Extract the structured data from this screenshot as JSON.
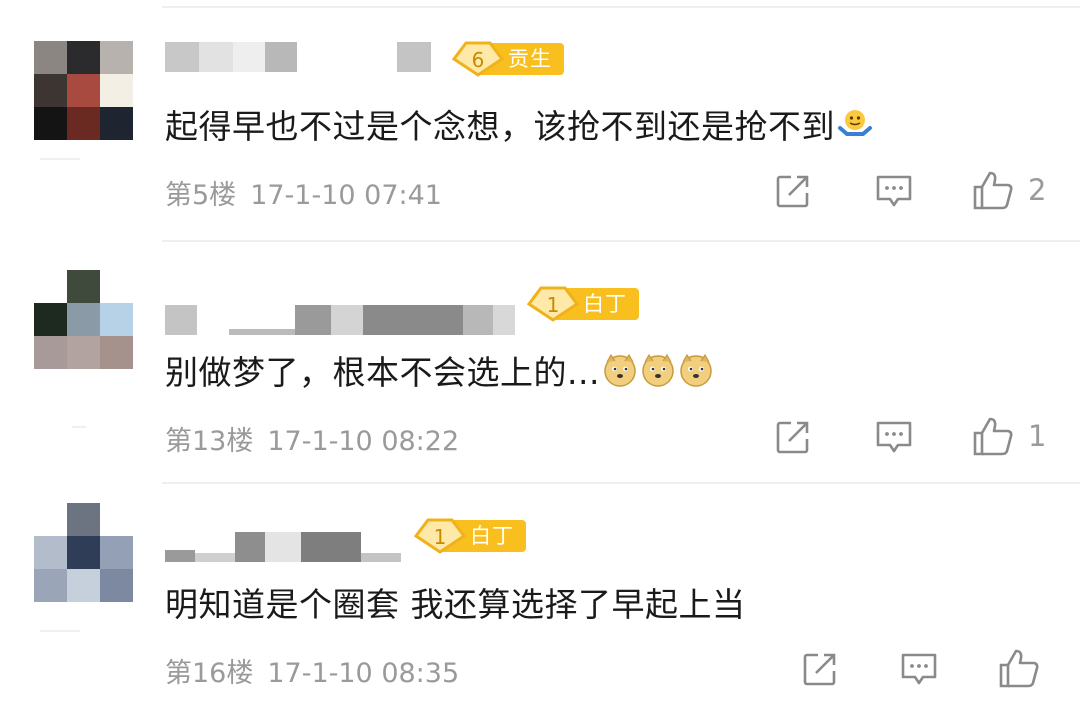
{
  "comments": [
    {
      "badge_level": "6",
      "badge_title": "贡生",
      "text": "起得早也不过是个念想，该抢不到还是抢不到",
      "emoji": "shrug-emoji",
      "floor": "第5楼",
      "time": "17-1-10 07:41",
      "likes": "2"
    },
    {
      "badge_level": "1",
      "badge_title": "白丁",
      "text": "别做梦了，根本不会选上的...",
      "emoji": "doge-emoji ×3",
      "floor": "第13楼",
      "time": "17-1-10 08:22",
      "likes": "1"
    },
    {
      "badge_level": "1",
      "badge_title": "白丁",
      "text": "明知道是个圈套 我还算选择了早起上当",
      "floor": "第16楼",
      "time": "17-1-10 08:35",
      "likes": ""
    }
  ],
  "icons": {
    "repost": "repost-icon",
    "reply": "comment-icon",
    "like": "thumbs-up-icon"
  },
  "colors": {
    "badge": "#f9bf1e",
    "meta_text": "#9a9a9a",
    "body_text": "#1a1a1a",
    "icon": "#8a8a8a"
  }
}
